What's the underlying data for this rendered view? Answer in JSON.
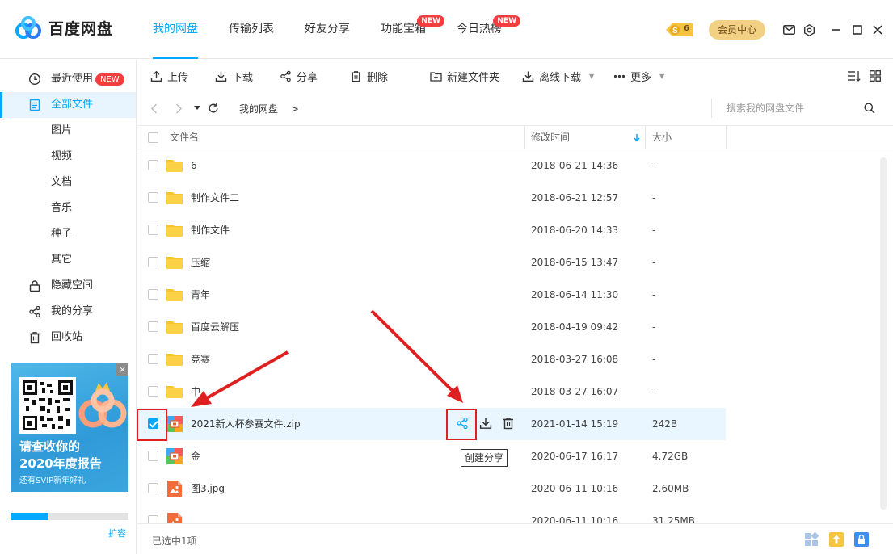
{
  "app": {
    "title": "百度网盘"
  },
  "nav": {
    "tabs": [
      {
        "label": "我的网盘",
        "active": true
      },
      {
        "label": "传输列表"
      },
      {
        "label": "好友分享"
      },
      {
        "label": "功能宝箱",
        "badge": "NEW"
      },
      {
        "label": "今日热榜",
        "badge": "NEW"
      }
    ],
    "coin_count": "6",
    "vip_label": "会员中心"
  },
  "sidebar": {
    "items": [
      {
        "label": "最近使用",
        "icon": "clock-icon",
        "badge": "NEW"
      },
      {
        "label": "全部文件",
        "icon": "document-icon",
        "active": true
      },
      {
        "label": "图片"
      },
      {
        "label": "视频"
      },
      {
        "label": "文档"
      },
      {
        "label": "音乐"
      },
      {
        "label": "种子"
      },
      {
        "label": "其它"
      },
      {
        "label": "隐藏空间",
        "icon": "lock-icon"
      },
      {
        "label": "我的分享",
        "icon": "share-icon"
      },
      {
        "label": "回收站",
        "icon": "trash-icon"
      }
    ],
    "ad": {
      "line1": "请查收你的",
      "line2": "2020年度报告",
      "line3": "还有SVIP新年好礼",
      "close": "×"
    },
    "storage_fraction": 0.32,
    "expand_label": "扩容"
  },
  "toolbar": {
    "upload": "上传",
    "download": "下载",
    "share": "分享",
    "delete": "删除",
    "new_folder": "新建文件夹",
    "offline_download": "离线下载",
    "more": "更多"
  },
  "path": {
    "crumb": "我的网盘",
    "separator": ">",
    "search_placeholder": "搜索我的网盘文件"
  },
  "table": {
    "col_name": "文件名",
    "col_time": "修改时间",
    "col_size": "大小",
    "rows": [
      {
        "name": "6",
        "time": "2018-06-21 14:36",
        "size": "-",
        "type": "folder"
      },
      {
        "name": "制作文件二",
        "time": "2018-06-21 12:57",
        "size": "-",
        "type": "folder"
      },
      {
        "name": "制作文件",
        "time": "2018-06-20 14:33",
        "size": "-",
        "type": "folder"
      },
      {
        "name": "压缩",
        "time": "2018-06-15 13:47",
        "size": "-",
        "type": "folder"
      },
      {
        "name": "青年",
        "time": "2018-06-14 11:30",
        "size": "-",
        "type": "folder"
      },
      {
        "name": "百度云解压",
        "time": "2018-04-19 09:42",
        "size": "-",
        "type": "folder"
      },
      {
        "name": "竞赛",
        "time": "2018-03-27 16:08",
        "size": "-",
        "type": "folder"
      },
      {
        "name": "中",
        "time": "2018-03-27 16:07",
        "size": "-",
        "type": "folder"
      },
      {
        "name": "2021新人杯参赛文件.zip",
        "time": "2021-01-14 15:19",
        "size": "242B",
        "type": "zip",
        "selected": true
      },
      {
        "name": "金",
        "time": "2020-06-17 16:17",
        "size": "4.72GB",
        "type": "zip"
      },
      {
        "name": "图3.jpg",
        "time": "2020-06-11 10:16",
        "size": "2.60MB",
        "type": "image"
      },
      {
        "name": "",
        "time": "2020-06-11 10:16",
        "size": "31.25MB",
        "type": "image"
      }
    ]
  },
  "tooltip": "创建分享",
  "status": {
    "selected_text": "已选中1项"
  },
  "colors": {
    "accent": "#06a7ff",
    "annotation": "#e02020",
    "folder": "#f8c52b"
  }
}
